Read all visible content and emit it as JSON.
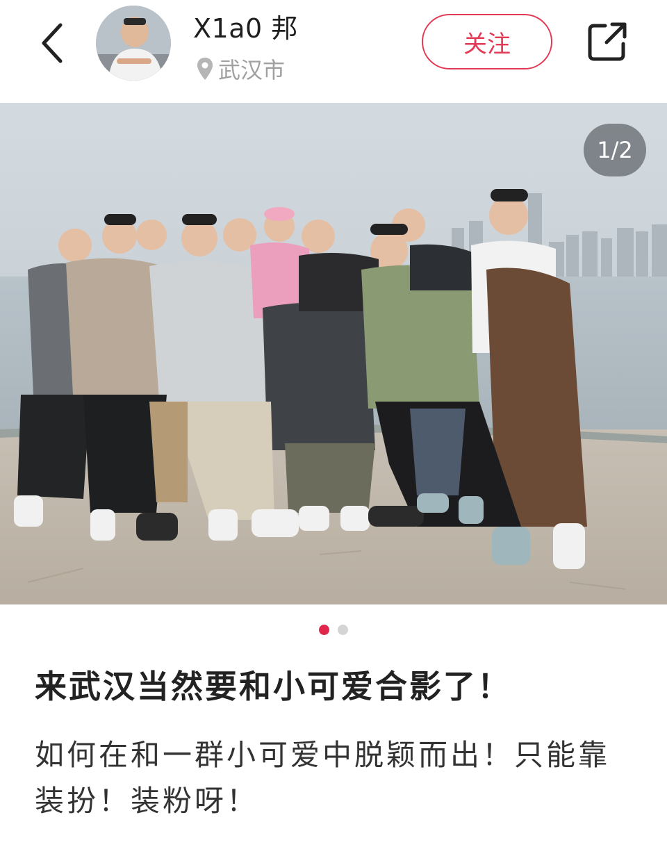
{
  "header": {
    "username": "X1a0 邦",
    "location": "武汉市",
    "follow_label": "关注"
  },
  "photo": {
    "counter": "1/2",
    "current_index": 1,
    "total": 2
  },
  "post": {
    "title": "来武汉当然要和小可爱合影了！",
    "body": "如何在和一群小可爱中脱颖而出！只能靠装扮！装粉呀！"
  },
  "colors": {
    "accent": "#e23a55",
    "active_dot": "#e0264a",
    "inactive_dot": "#d4d4d4",
    "location_gray": "#a0a0a0"
  },
  "icons": [
    "back-arrow-icon",
    "location-pin-icon",
    "share-icon"
  ]
}
